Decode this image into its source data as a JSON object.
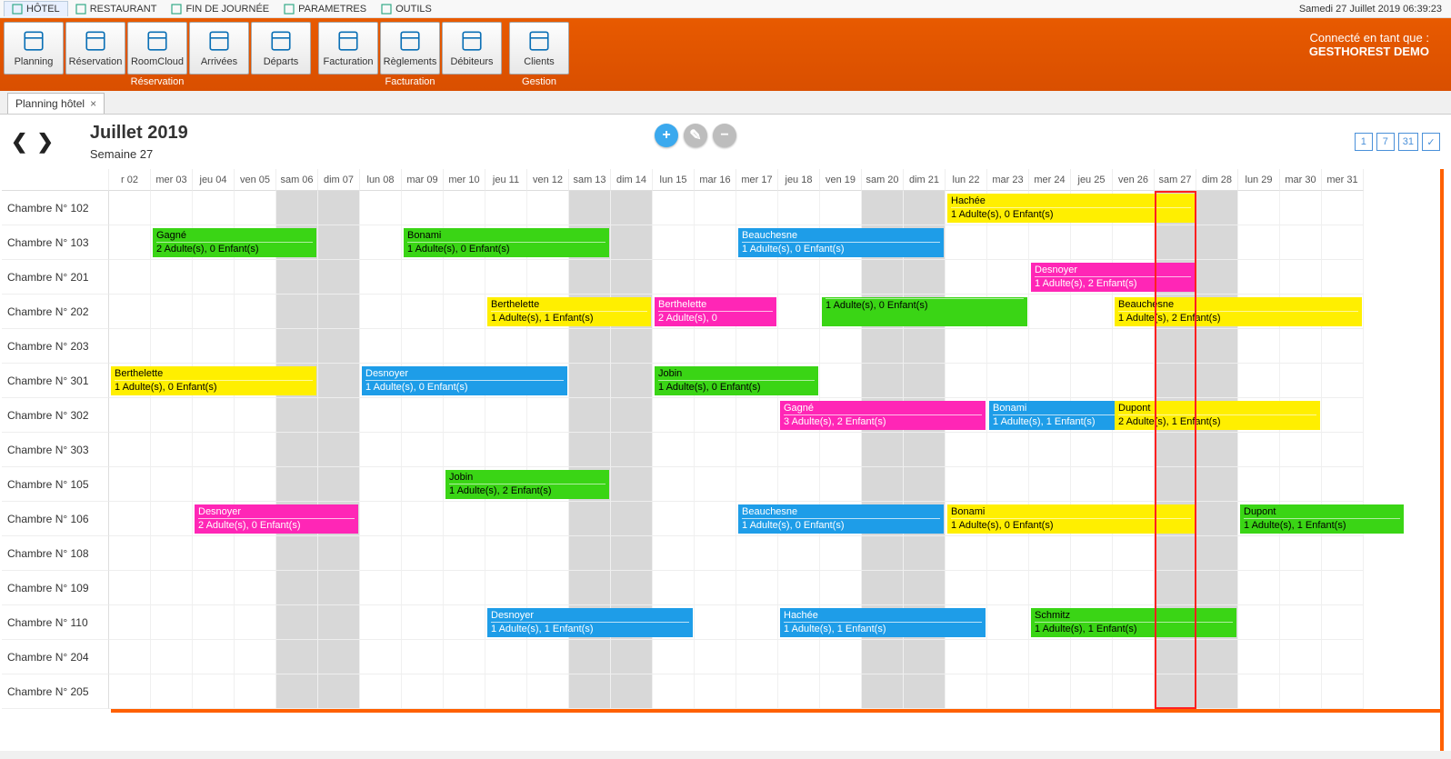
{
  "topmenu": {
    "items": [
      {
        "label": "HÔTEL",
        "icon": "hotel-icon",
        "active": true
      },
      {
        "label": "RESTAURANT",
        "icon": "restaurant-icon"
      },
      {
        "label": "FIN DE JOURNÉE",
        "icon": "endday-icon"
      },
      {
        "label": "PARAMETRES",
        "icon": "settings-icon"
      },
      {
        "label": "OUTILS",
        "icon": "tools-icon"
      }
    ],
    "datetime": "Samedi 27 Juillet 2019 06:39:23"
  },
  "ribbon": {
    "groups": [
      {
        "label": "Réservation",
        "buttons": [
          {
            "label": "Planning",
            "icon": "calendar-icon"
          },
          {
            "label": "Réservation",
            "icon": "clock-icon"
          },
          {
            "label": "RoomCloud",
            "icon": "cloud-icon"
          },
          {
            "label": "Arrivées",
            "icon": "arrivals-icon"
          },
          {
            "label": "Départs",
            "icon": "departures-icon"
          }
        ]
      },
      {
        "label": "Facturation",
        "buttons": [
          {
            "label": "Facturation",
            "icon": "invoice-icon"
          },
          {
            "label": "Règlements",
            "icon": "payment-icon"
          },
          {
            "label": "Débiteurs",
            "icon": "debtors-icon"
          }
        ]
      },
      {
        "label": "Gestion",
        "buttons": [
          {
            "label": "Clients",
            "icon": "clients-icon"
          }
        ]
      }
    ],
    "connected_label": "Connecté en tant que :",
    "connected_user": "GESTHOREST DEMO"
  },
  "doctab": {
    "label": "Planning hôtel"
  },
  "planning": {
    "title": "Juillet 2019",
    "subtitle": "Semaine 27",
    "view_buttons": [
      "1",
      "7",
      "31",
      "✓"
    ],
    "days": [
      "r 02",
      "mer 03",
      "jeu 04",
      "ven 05",
      "sam 06",
      "dim 07",
      "lun 08",
      "mar 09",
      "mer 10",
      "jeu 11",
      "ven 12",
      "sam 13",
      "dim 14",
      "lun 15",
      "mar 16",
      "mer 17",
      "jeu 18",
      "ven 19",
      "sam 20",
      "dim 21",
      "lun 22",
      "mar 23",
      "mer 24",
      "jeu 25",
      "ven 26",
      "sam 27",
      "dim 28",
      "lun 29",
      "mar 30",
      "mer 31"
    ],
    "weekend_cols": [
      4,
      5,
      11,
      12,
      18,
      19,
      25,
      26
    ],
    "today_col": 25,
    "rooms": [
      "Chambre N° 102",
      "Chambre N° 103",
      "Chambre N° 201",
      "Chambre N° 202",
      "Chambre N° 203",
      "Chambre N° 301",
      "Chambre N° 302",
      "Chambre N° 303",
      "Chambre N° 105",
      "Chambre N° 106",
      "Chambre N° 108",
      "Chambre N° 109",
      "Chambre N° 110",
      "Chambre N° 204",
      "Chambre N° 205"
    ],
    "reservations": [
      {
        "room": 0,
        "start": 20,
        "end": 25,
        "name": "Hachée",
        "guests": "1 Adulte(s), 0 Enfant(s)",
        "color": "yellow"
      },
      {
        "room": 1,
        "start": 1,
        "end": 4,
        "name": "Gagné",
        "guests": "2 Adulte(s), 0 Enfant(s)",
        "color": "green"
      },
      {
        "room": 1,
        "start": 7,
        "end": 11,
        "name": "Bonami",
        "guests": "1 Adulte(s), 0 Enfant(s)",
        "color": "green"
      },
      {
        "room": 1,
        "start": 15,
        "end": 19,
        "name": "Beauchesne",
        "guests": "1 Adulte(s), 0 Enfant(s)",
        "color": "blue"
      },
      {
        "room": 2,
        "start": 22,
        "end": 25,
        "name": "Desnoyer",
        "guests": "1 Adulte(s), 2 Enfant(s)",
        "color": "pink"
      },
      {
        "room": 3,
        "start": 9,
        "end": 12,
        "name": "Berthelette",
        "guests": "1 Adulte(s), 1 Enfant(s)",
        "color": "yellow"
      },
      {
        "room": 3,
        "start": 13,
        "end": 15,
        "name": "Berthelette",
        "guests": "2 Adulte(s), 0",
        "color": "pink"
      },
      {
        "room": 3,
        "start": 17,
        "end": 21,
        "name": "",
        "guests": "1 Adulte(s), 0 Enfant(s)",
        "color": "green"
      },
      {
        "room": 3,
        "start": 24,
        "end": 29,
        "name": "Beauchesne",
        "guests": "1 Adulte(s), 2 Enfant(s)",
        "color": "yellow"
      },
      {
        "room": 5,
        "start": 0,
        "end": 4,
        "name": "Berthelette",
        "guests": "1 Adulte(s), 0 Enfant(s)",
        "color": "yellow"
      },
      {
        "room": 5,
        "start": 6,
        "end": 10,
        "name": "Desnoyer",
        "guests": "1 Adulte(s), 0 Enfant(s)",
        "color": "blue"
      },
      {
        "room": 5,
        "start": 13,
        "end": 16,
        "name": "Jobin",
        "guests": "1 Adulte(s), 0 Enfant(s)",
        "color": "green"
      },
      {
        "room": 6,
        "start": 16,
        "end": 20,
        "name": "Gagné",
        "guests": "3 Adulte(s), 2 Enfant(s)",
        "color": "pink"
      },
      {
        "room": 6,
        "start": 21,
        "end": 24,
        "name": "Bonami",
        "guests": "1 Adulte(s), 1 Enfant(s)",
        "color": "blue"
      },
      {
        "room": 6,
        "start": 24,
        "end": 28,
        "name": "Dupont",
        "guests": "2 Adulte(s), 1 Enfant(s)",
        "color": "yellow"
      },
      {
        "room": 8,
        "start": 8,
        "end": 11,
        "name": "Jobin",
        "guests": "1 Adulte(s), 2 Enfant(s)",
        "color": "green"
      },
      {
        "room": 9,
        "start": 2,
        "end": 5,
        "name": "Desnoyer",
        "guests": "2 Adulte(s), 0 Enfant(s)",
        "color": "pink"
      },
      {
        "room": 9,
        "start": 15,
        "end": 19,
        "name": "Beauchesne",
        "guests": "1 Adulte(s), 0 Enfant(s)",
        "color": "blue"
      },
      {
        "room": 9,
        "start": 20,
        "end": 25,
        "name": "Bonami",
        "guests": "1 Adulte(s), 0 Enfant(s)",
        "color": "yellow"
      },
      {
        "room": 9,
        "start": 27,
        "end": 30,
        "name": "Dupont",
        "guests": "1 Adulte(s), 1 Enfant(s)",
        "color": "green"
      },
      {
        "room": 12,
        "start": 9,
        "end": 13,
        "name": "Desnoyer",
        "guests": "1 Adulte(s), 1 Enfant(s)",
        "color": "blue"
      },
      {
        "room": 12,
        "start": 16,
        "end": 20,
        "name": "Hachée",
        "guests": "1 Adulte(s), 1 Enfant(s)",
        "color": "blue"
      },
      {
        "room": 12,
        "start": 22,
        "end": 26,
        "name": "Schmitz",
        "guests": "1 Adulte(s), 1 Enfant(s)",
        "color": "green"
      }
    ]
  }
}
